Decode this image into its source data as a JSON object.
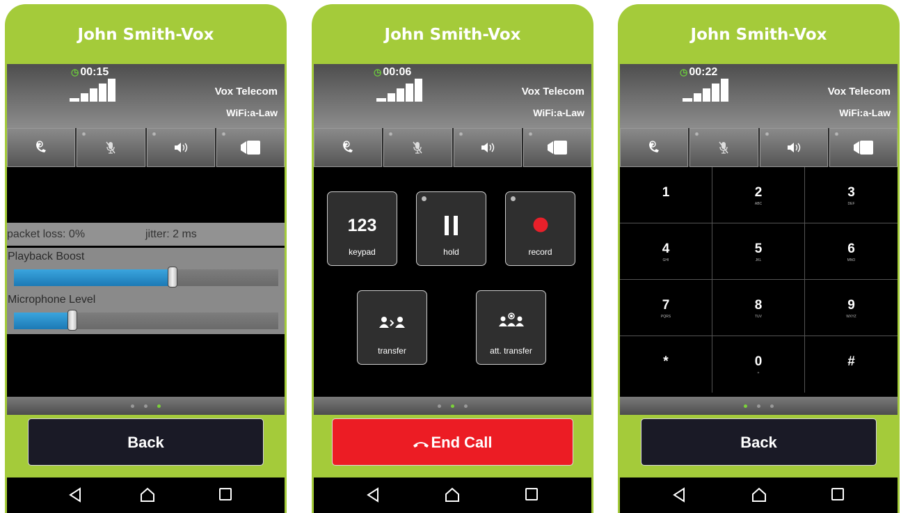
{
  "screens": [
    {
      "title": "John Smith-Vox",
      "timer": "00:15",
      "carrier": "Vox Telecom",
      "codec": "WiFi:a-Law",
      "packet_loss": "packet loss: 0%",
      "jitter": "jitter: 2 ms",
      "playback_label": "Playback Boost",
      "playback_level": 0.6,
      "mic_label": "Microphone Level",
      "mic_level": 0.22,
      "page_indicator": {
        "count": 3,
        "active": 3
      },
      "button": "Back"
    },
    {
      "title": "John Smith-Vox",
      "timer": "00:06",
      "carrier": "Vox Telecom",
      "codec": "WiFi:a-Law",
      "keypad_icon": "123",
      "keypad_label": "keypad",
      "hold_label": "hold",
      "record_label": "record",
      "transfer_label": "transfer",
      "att_transfer_label": "att. transfer",
      "page_indicator": {
        "count": 3,
        "active": 2
      },
      "button": "End Call"
    },
    {
      "title": "John Smith-Vox",
      "timer": "00:22",
      "carrier": "Vox Telecom",
      "codec": "WiFi:a-Law",
      "keys": [
        {
          "d": "1",
          "l": ""
        },
        {
          "d": "2",
          "l": "ABC"
        },
        {
          "d": "3",
          "l": "DEF"
        },
        {
          "d": "4",
          "l": "GHI"
        },
        {
          "d": "5",
          "l": "JKL"
        },
        {
          "d": "6",
          "l": "MNO"
        },
        {
          "d": "7",
          "l": "PQRS"
        },
        {
          "d": "8",
          "l": "TUV"
        },
        {
          "d": "9",
          "l": "WXYZ"
        },
        {
          "d": "*",
          "l": ""
        },
        {
          "d": "0",
          "l": "+"
        },
        {
          "d": "#",
          "l": ""
        }
      ],
      "page_indicator": {
        "count": 3,
        "active": 1
      },
      "button": "Back"
    }
  ],
  "toolbar_icons": [
    "add-call-icon",
    "mute-icon",
    "speaker-icon",
    "video-icon"
  ],
  "nav_icons": [
    "back-icon",
    "home-icon",
    "recents-icon"
  ],
  "colors": {
    "brand": "#a4cb3a",
    "end_call": "#ec1c24",
    "active_dot": "#7bd13a",
    "slider": "#2a8fcf"
  }
}
